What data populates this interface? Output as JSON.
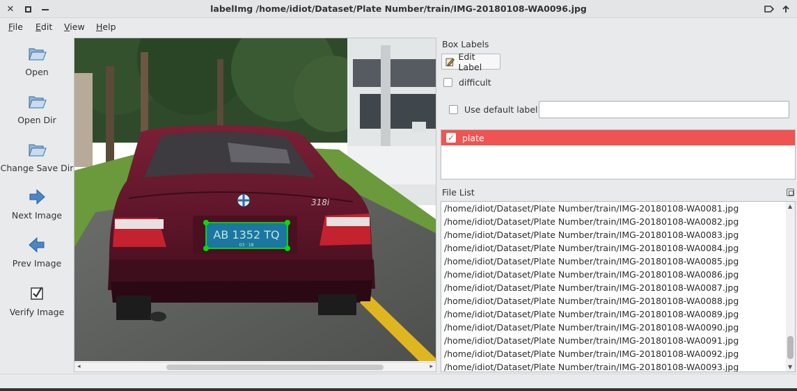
{
  "window": {
    "title": "labelImg /home/idiot/Dataset/Plate Number/train/IMG-20180108-WA0096.jpg",
    "controls": [
      "close-icon",
      "maximize-icon",
      "minimize-icon"
    ],
    "right_icons": [
      "tag-icon",
      "keep-above-icon"
    ]
  },
  "menu": [
    {
      "label": "File",
      "mnemonic": "F"
    },
    {
      "label": "Edit",
      "mnemonic": "E"
    },
    {
      "label": "View",
      "mnemonic": "V"
    },
    {
      "label": "Help",
      "mnemonic": "H"
    }
  ],
  "toolbar": {
    "items": [
      {
        "label": "Open",
        "icon": "folder-open-icon"
      },
      {
        "label": "Open Dir",
        "icon": "folder-open-icon"
      },
      {
        "label": "Change Save Dir",
        "icon": "folder-open-icon"
      },
      {
        "label": "Next Image",
        "icon": "arrow-right-icon"
      },
      {
        "label": "Prev Image",
        "icon": "arrow-left-icon"
      },
      {
        "label": "Verify Image",
        "icon": "checkbox-icon"
      }
    ],
    "more_glyph": "»"
  },
  "canvas": {
    "plate_text": "AB 1352 TQ",
    "plate_subtext": "03 · 18",
    "car_badge": "318i",
    "box_color": "#00ff00"
  },
  "dock": {
    "box_labels_title": "Box Labels",
    "edit_label_button": "Edit Label",
    "difficult_label": "difficult",
    "use_default_label": "Use default label",
    "default_label_value": "",
    "labels": [
      {
        "name": "plate",
        "checked": true,
        "color": "#ee5451"
      }
    ],
    "file_list_title": "File List",
    "files": [
      "/home/idiot/Dataset/Plate Number/train/IMG-20180108-WA0081.jpg",
      "/home/idiot/Dataset/Plate Number/train/IMG-20180108-WA0082.jpg",
      "/home/idiot/Dataset/Plate Number/train/IMG-20180108-WA0083.jpg",
      "/home/idiot/Dataset/Plate Number/train/IMG-20180108-WA0084.jpg",
      "/home/idiot/Dataset/Plate Number/train/IMG-20180108-WA0085.jpg",
      "/home/idiot/Dataset/Plate Number/train/IMG-20180108-WA0086.jpg",
      "/home/idiot/Dataset/Plate Number/train/IMG-20180108-WA0087.jpg",
      "/home/idiot/Dataset/Plate Number/train/IMG-20180108-WA0088.jpg",
      "/home/idiot/Dataset/Plate Number/train/IMG-20180108-WA0089.jpg",
      "/home/idiot/Dataset/Plate Number/train/IMG-20180108-WA0090.jpg",
      "/home/idiot/Dataset/Plate Number/train/IMG-20180108-WA0091.jpg",
      "/home/idiot/Dataset/Plate Number/train/IMG-20180108-WA0092.jpg",
      "/home/idiot/Dataset/Plate Number/train/IMG-20180108-WA0093.jpg"
    ]
  },
  "status": {
    "text": ""
  }
}
